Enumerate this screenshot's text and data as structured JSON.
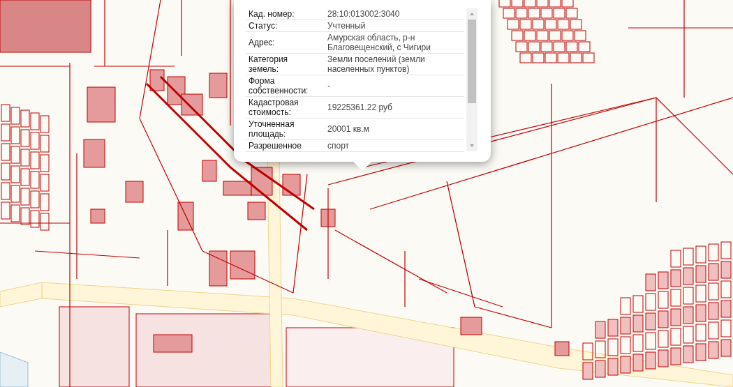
{
  "popup": {
    "rows": [
      {
        "label": "Кад. номер:",
        "value": "28:10:013002:3040"
      },
      {
        "label": "Статус:",
        "value": "Учтенный"
      },
      {
        "label": "Адрес:",
        "value": "Амурская область, р-н Благовещенский, с Чигири"
      },
      {
        "label": "Категория земель:",
        "value": "Земли поселений (земли населенных пунктов)"
      },
      {
        "label": "Форма собственности:",
        "value": "-"
      },
      {
        "label": "Кадастровая стоимость:",
        "value": "19225361.22 руб"
      },
      {
        "label": "Уточненная площадь:",
        "value": "20001 кв.м"
      },
      {
        "label": "Разрешенное",
        "value": "спорт"
      }
    ]
  }
}
